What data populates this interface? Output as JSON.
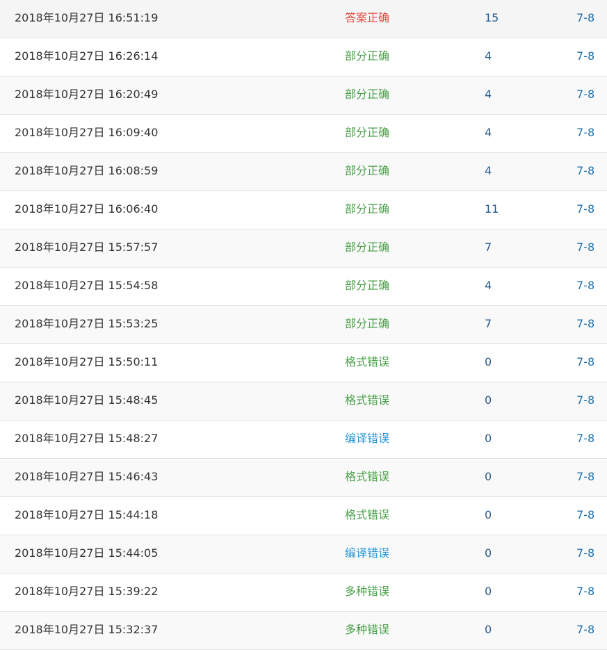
{
  "colors": {
    "accepted": "#e0493e",
    "partial": "#4aa04a",
    "format_error": "#4aa04a",
    "compile_error": "#2a97d8",
    "multiple_errors": "#4aa04a",
    "score": "#2a5a8c",
    "problem": "#1f6fa8"
  },
  "submissions": [
    {
      "time": "2018年10月27日 16:51:19",
      "status": "答案正确",
      "status_key": "ac",
      "score": "15",
      "problem": "7-8"
    },
    {
      "time": "2018年10月27日 16:26:14",
      "status": "部分正确",
      "status_key": "partial",
      "score": "4",
      "problem": "7-8"
    },
    {
      "time": "2018年10月27日 16:20:49",
      "status": "部分正确",
      "status_key": "partial",
      "score": "4",
      "problem": "7-8"
    },
    {
      "time": "2018年10月27日 16:09:40",
      "status": "部分正确",
      "status_key": "partial",
      "score": "4",
      "problem": "7-8"
    },
    {
      "time": "2018年10月27日 16:08:59",
      "status": "部分正确",
      "status_key": "partial",
      "score": "4",
      "problem": "7-8"
    },
    {
      "time": "2018年10月27日 16:06:40",
      "status": "部分正确",
      "status_key": "partial",
      "score": "11",
      "problem": "7-8"
    },
    {
      "time": "2018年10月27日 15:57:57",
      "status": "部分正确",
      "status_key": "partial",
      "score": "7",
      "problem": "7-8"
    },
    {
      "time": "2018年10月27日 15:54:58",
      "status": "部分正确",
      "status_key": "partial",
      "score": "4",
      "problem": "7-8"
    },
    {
      "time": "2018年10月27日 15:53:25",
      "status": "部分正确",
      "status_key": "partial",
      "score": "7",
      "problem": "7-8"
    },
    {
      "time": "2018年10月27日 15:50:11",
      "status": "格式错误",
      "status_key": "format",
      "score": "0",
      "problem": "7-8"
    },
    {
      "time": "2018年10月27日 15:48:45",
      "status": "格式错误",
      "status_key": "format",
      "score": "0",
      "problem": "7-8"
    },
    {
      "time": "2018年10月27日 15:48:27",
      "status": "编译错误",
      "status_key": "compile",
      "score": "0",
      "problem": "7-8"
    },
    {
      "time": "2018年10月27日 15:46:43",
      "status": "格式错误",
      "status_key": "format",
      "score": "0",
      "problem": "7-8"
    },
    {
      "time": "2018年10月27日 15:44:18",
      "status": "格式错误",
      "status_key": "format",
      "score": "0",
      "problem": "7-8"
    },
    {
      "time": "2018年10月27日 15:44:05",
      "status": "编译错误",
      "status_key": "compile",
      "score": "0",
      "problem": "7-8"
    },
    {
      "time": "2018年10月27日 15:39:22",
      "status": "多种错误",
      "status_key": "multi",
      "score": "0",
      "problem": "7-8"
    },
    {
      "time": "2018年10月27日 15:32:37",
      "status": "多种错误",
      "status_key": "multi",
      "score": "0",
      "problem": "7-8"
    }
  ]
}
